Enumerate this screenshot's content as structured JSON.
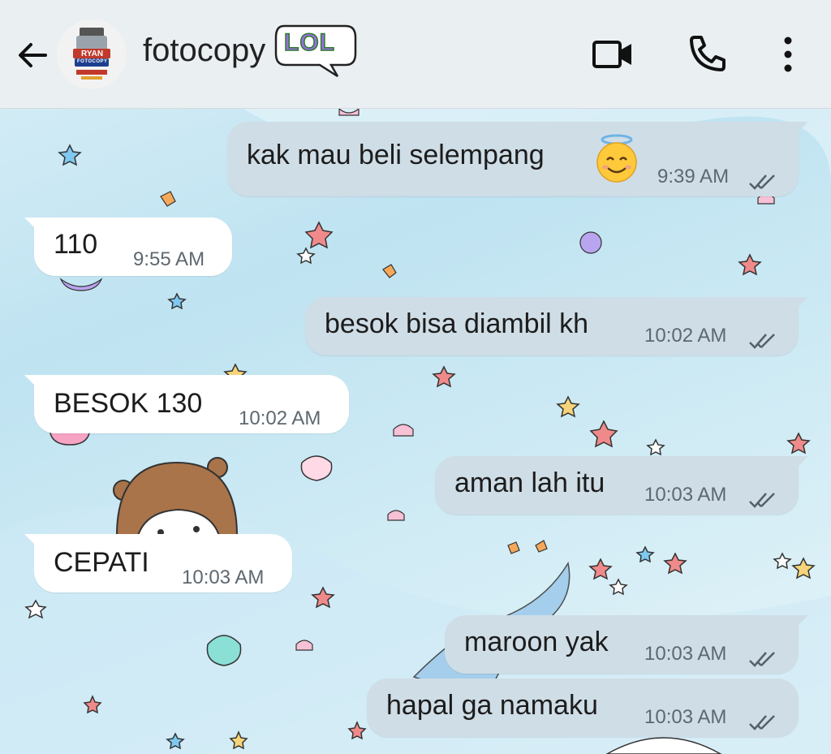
{
  "header": {
    "contact_name": "fotocopy",
    "sticker_text": "LOL",
    "avatar_text_line1": "RYAN",
    "avatar_text_line2": "FOTOCOPY",
    "icons": [
      "back-arrow-icon",
      "video-call-icon",
      "voice-call-icon",
      "more-options-icon"
    ]
  },
  "messages": [
    {
      "direction": "out",
      "text": "kak mau beli selempang",
      "emoji": "smiling-face-with-halo",
      "time": "9:39 AM",
      "status": "read"
    },
    {
      "direction": "in",
      "text": "110",
      "time": "9:55 AM"
    },
    {
      "direction": "out",
      "text": "besok bisa diambil kh",
      "time": "10:02 AM",
      "status": "read"
    },
    {
      "direction": "in",
      "text": "BESOK 130",
      "time": "10:02 AM"
    },
    {
      "direction": "out",
      "text": "aman lah itu",
      "time": "10:03 AM",
      "status": "read"
    },
    {
      "direction": "in",
      "text": "CEPATI",
      "time": "10:03 AM"
    },
    {
      "direction": "out",
      "text": "maroon yak",
      "time": "10:03 AM",
      "status": "read"
    },
    {
      "direction": "out",
      "text": "hapal ga namaku",
      "time": "10:03 AM",
      "status": "read"
    }
  ],
  "colors": {
    "header_bg": "#eaeff2",
    "outgoing_bubble": "#cfdde6",
    "incoming_bubble": "#ffffff",
    "sticker_purple": "#b98be8",
    "sticker_green": "#7ee06a"
  }
}
